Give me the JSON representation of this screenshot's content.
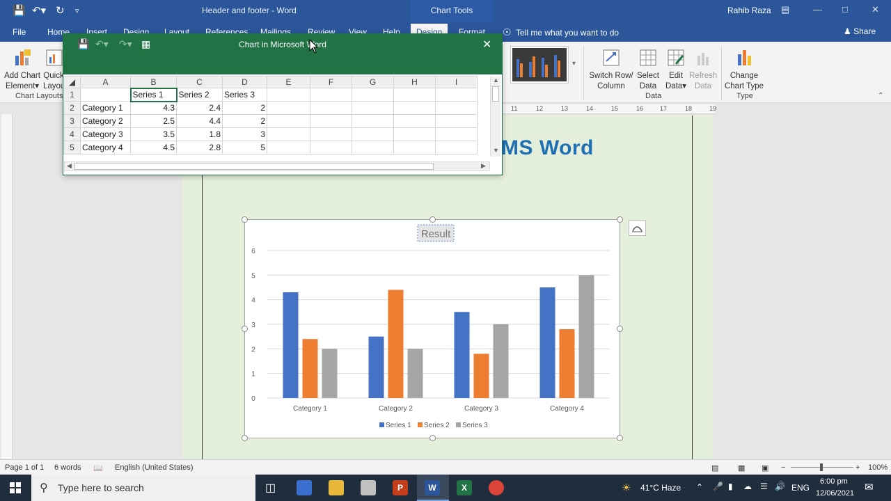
{
  "titlebar": {
    "doc_title": "Header and footer  -  Word",
    "context_tab": "Chart Tools",
    "user": "Rahib Raza"
  },
  "tabs": [
    {
      "label": "File"
    },
    {
      "label": "Home"
    },
    {
      "label": "Insert"
    },
    {
      "label": "Design"
    },
    {
      "label": "Layout"
    },
    {
      "label": "References"
    },
    {
      "label": "Mailings"
    },
    {
      "label": "Review"
    },
    {
      "label": "View"
    },
    {
      "label": "Help"
    },
    {
      "label": "Design"
    },
    {
      "label": "Format"
    }
  ],
  "tell_me": "Tell me what you want to do",
  "share": "Share",
  "ribbon": {
    "add_chart_element": "Add Chart Element",
    "quick_layout": "Quick Layout",
    "chart_layouts_group": "Chart Layouts",
    "switch_row_column": "Switch Row/ Column",
    "select_data": "Select Data",
    "edit_data": "Edit Data",
    "refresh_data": "Refresh Data",
    "data_group": "Data",
    "change_chart_type": "Change Chart Type",
    "type_group": "Type"
  },
  "sheet": {
    "title": "Chart in Microsoft Word",
    "columns": [
      "A",
      "B",
      "C",
      "D",
      "E",
      "F",
      "G",
      "H",
      "I"
    ],
    "rows": [
      {
        "n": "1",
        "cells": [
          "",
          "Series 1",
          "Series 2",
          "Series 3"
        ]
      },
      {
        "n": "2",
        "cells": [
          "Category 1",
          "4.3",
          "2.4",
          "2"
        ]
      },
      {
        "n": "3",
        "cells": [
          "Category 2",
          "2.5",
          "4.4",
          "2"
        ]
      },
      {
        "n": "4",
        "cells": [
          "Category 3",
          "3.5",
          "1.8",
          "3"
        ]
      },
      {
        "n": "5",
        "cells": [
          "Category 4",
          "4.5",
          "2.8",
          "5"
        ]
      }
    ]
  },
  "doc": {
    "heading": "MS Word",
    "ruler_marks": [
      "11",
      "12",
      "13",
      "14",
      "15",
      "16",
      "17",
      "18",
      "19"
    ]
  },
  "chart_data": {
    "type": "bar",
    "title": "Result",
    "categories": [
      "Category 1",
      "Category 2",
      "Category 3",
      "Category 4"
    ],
    "series": [
      {
        "name": "Series 1",
        "values": [
          4.3,
          2.5,
          3.5,
          4.5
        ],
        "color": "#4472c4"
      },
      {
        "name": "Series 2",
        "values": [
          2.4,
          4.4,
          1.8,
          2.8
        ],
        "color": "#ed7d31"
      },
      {
        "name": "Series 3",
        "values": [
          2,
          2,
          3,
          5
        ],
        "color": "#a5a5a5"
      }
    ],
    "yticks": [
      "0",
      "1",
      "2",
      "3",
      "4",
      "5",
      "6"
    ],
    "ylim": [
      0,
      6
    ],
    "grid": true,
    "legend": "bottom"
  },
  "status": {
    "page": "Page 1 of 1",
    "words": "6 words",
    "language": "English (United States)",
    "zoom": "100%"
  },
  "taskbar": {
    "search_placeholder": "Type here to search",
    "weather": "41°C  Haze",
    "lang": "ENG",
    "time": "6:00 pm",
    "date": "12/06/2021"
  },
  "colors": {
    "word_blue": "#2b579a",
    "excel_green": "#217346",
    "heading_blue": "#1f6fb2",
    "page_bg": "#e5f0dc"
  }
}
